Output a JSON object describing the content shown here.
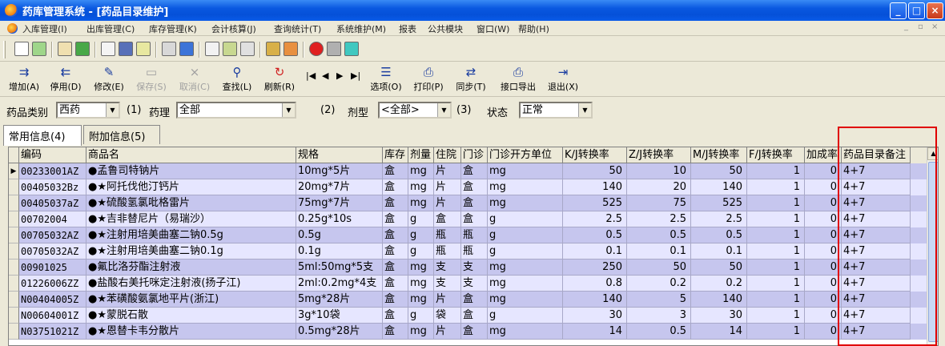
{
  "window": {
    "title": "药库管理系统 - [药品目录维护]",
    "controls": [
      "_",
      "□",
      "×"
    ]
  },
  "menu": [
    "入库管理(I)",
    "出库管理(C)",
    "库存管理(K)",
    "会计核算(J)",
    "查询统计(T)",
    "系统维护(M)",
    "报表",
    "公共模块",
    "窗口(W)",
    "帮助(H)"
  ],
  "icon_toolbar": [
    "new-doc-icon",
    "import-icon",
    "edit-doc-icon",
    "check-mail-icon",
    "clipboard-icon",
    "image-icon",
    "calc-icon",
    "print-preview-icon",
    "table-icon",
    "report-icon",
    "tools-icon",
    "search-icon",
    "car-icon",
    "thermometer-icon",
    "stop-icon",
    "eraser-icon",
    "exit-icon"
  ],
  "actions": [
    {
      "label": "增加(A)",
      "icon": "add-icon",
      "enabled": true
    },
    {
      "label": "停用(D)",
      "icon": "disable-icon",
      "enabled": true
    },
    {
      "label": "修改(E)",
      "icon": "edit-icon",
      "enabled": true
    },
    {
      "label": "保存(S)",
      "icon": "save-icon",
      "enabled": false
    },
    {
      "label": "取消(C)",
      "icon": "cancel-icon",
      "enabled": false
    },
    {
      "label": "查找(L)",
      "icon": "find-icon",
      "enabled": true
    },
    {
      "label": "刷新(R)",
      "icon": "refresh-icon",
      "enabled": true
    },
    {
      "label": "选项(O)",
      "icon": "options-icon",
      "enabled": true
    },
    {
      "label": "打印(P)",
      "icon": "print-icon",
      "enabled": true
    },
    {
      "label": "同步(T)",
      "icon": "sync-icon",
      "enabled": true
    },
    {
      "label": "接口导出",
      "icon": "export-icon",
      "enabled": true
    },
    {
      "label": "退出(X)",
      "icon": "exit-icon",
      "enabled": true
    }
  ],
  "nav_glyphs": [
    "|◀",
    "◀",
    "▶",
    "▶|"
  ],
  "filters": {
    "category_label": "药品类别",
    "category_value": "西药",
    "marker1": "(1)",
    "pharmacology_label": "药理",
    "pharmacology_value": "全部",
    "marker2": "(2)",
    "dosage_label": "剂型",
    "dosage_value": "<全部>",
    "marker3": "(3)",
    "status_label": "状态",
    "status_value": "正常"
  },
  "tabs": [
    {
      "label": "常用信息(4)",
      "active": true
    },
    {
      "label": "附加信息(5)",
      "active": false
    }
  ],
  "grid": {
    "columns": [
      "编码",
      "商品名",
      "规格",
      "库存",
      "剂量",
      "住院",
      "门诊",
      "门诊开方单位",
      "K/J转换率",
      "Z/J转换率",
      "M/J转换率",
      "F/J转换率",
      "加成率",
      "药品目录备注"
    ],
    "rows": [
      [
        "00233001AZ",
        "●孟鲁司特钠片",
        "10mg*5片",
        "盒",
        "mg",
        "片",
        "盒",
        "mg",
        "50",
        "10",
        "50",
        "1",
        "0",
        "4+7"
      ],
      [
        "00405032Bz",
        "●★阿托伐他汀钙片",
        "20mg*7片",
        "盒",
        "mg",
        "片",
        "盒",
        "mg",
        "140",
        "20",
        "140",
        "1",
        "0",
        "4+7"
      ],
      [
        "00405037aZ",
        "●★硫酸氢氯吡格雷片",
        "75mg*7片",
        "盒",
        "mg",
        "片",
        "盒",
        "mg",
        "525",
        "75",
        "525",
        "1",
        "0",
        "4+7"
      ],
      [
        "00702004",
        "●★吉非替尼片（易瑞沙）",
        "0.25g*10s",
        "盒",
        "g",
        "盒",
        "盒",
        "g",
        "2.5",
        "2.5",
        "2.5",
        "1",
        "0",
        "4+7"
      ],
      [
        "00705032AZ",
        "●★注射用培美曲塞二钠0.5g",
        "0.5g",
        "盒",
        "g",
        "瓶",
        "瓶",
        "g",
        "0.5",
        "0.5",
        "0.5",
        "1",
        "0",
        "4+7"
      ],
      [
        "00705032AZ",
        "●★注射用培美曲塞二钠0.1g",
        "0.1g",
        "盒",
        "g",
        "瓶",
        "瓶",
        "g",
        "0.1",
        "0.1",
        "0.1",
        "1",
        "0",
        "4+7"
      ],
      [
        "00901025",
        "●氟比洛芬酯注射液",
        "5ml:50mg*5支",
        "盒",
        "mg",
        "支",
        "支",
        "mg",
        "250",
        "50",
        "50",
        "1",
        "0",
        "4+7"
      ],
      [
        "01226006ZZ",
        "●盐酸右美托咪定注射液(扬子江)",
        "2ml:0.2mg*4支",
        "盒",
        "mg",
        "支",
        "支",
        "mg",
        "0.8",
        "0.2",
        "0.2",
        "1",
        "0",
        "4+7"
      ],
      [
        "N00404005Z",
        "●★苯磺酸氨氯地平片(浙江)",
        "5mg*28片",
        "盒",
        "mg",
        "片",
        "盒",
        "mg",
        "140",
        "5",
        "140",
        "1",
        "0",
        "4+7"
      ],
      [
        "N00604001Z",
        "●★蒙脱石散",
        "3g*10袋",
        "盒",
        "g",
        "袋",
        "盒",
        "g",
        "30",
        "3",
        "30",
        "1",
        "0",
        "4+7"
      ],
      [
        "N03751021Z",
        "●★恩替卡韦分散片",
        "0.5mg*28片",
        "盒",
        "mg",
        "片",
        "盒",
        "mg",
        "14",
        "0.5",
        "14",
        "1",
        "0",
        "4+7"
      ]
    ],
    "selected_row": 0
  },
  "colors": {
    "row_odd": "#c6c6ee",
    "row_even": "#e6e6ff",
    "highlight_box": "#e00000",
    "title_bar": "#0a58e0"
  }
}
